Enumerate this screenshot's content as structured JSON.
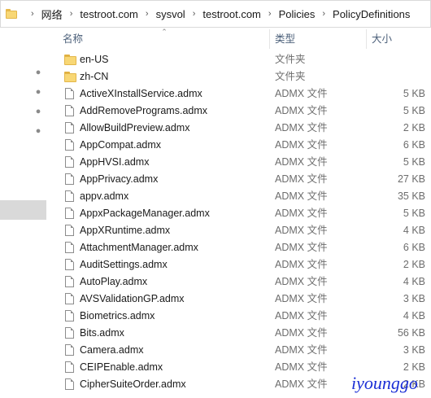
{
  "address_bar": {
    "crumbs": [
      "网络",
      "testroot.com",
      "sysvol",
      "testroot.com",
      "Policies",
      "PolicyDefinitions"
    ],
    "separator": "›"
  },
  "columns": {
    "name": "名称",
    "type": "类型",
    "size": "大小"
  },
  "files": [
    {
      "name": "en-US",
      "type": "文件夹",
      "size": "",
      "icon": "folder-icon"
    },
    {
      "name": "zh-CN",
      "type": "文件夹",
      "size": "",
      "icon": "folder-icon"
    },
    {
      "name": "ActiveXInstallService.admx",
      "type": "ADMX 文件",
      "size": "5 KB",
      "icon": "document-icon"
    },
    {
      "name": "AddRemovePrograms.admx",
      "type": "ADMX 文件",
      "size": "5 KB",
      "icon": "document-icon"
    },
    {
      "name": "AllowBuildPreview.admx",
      "type": "ADMX 文件",
      "size": "2 KB",
      "icon": "document-icon"
    },
    {
      "name": "AppCompat.admx",
      "type": "ADMX 文件",
      "size": "6 KB",
      "icon": "document-icon"
    },
    {
      "name": "AppHVSI.admx",
      "type": "ADMX 文件",
      "size": "5 KB",
      "icon": "document-icon"
    },
    {
      "name": "AppPrivacy.admx",
      "type": "ADMX 文件",
      "size": "27 KB",
      "icon": "document-icon"
    },
    {
      "name": "appv.admx",
      "type": "ADMX 文件",
      "size": "35 KB",
      "icon": "document-icon"
    },
    {
      "name": "AppxPackageManager.admx",
      "type": "ADMX 文件",
      "size": "5 KB",
      "icon": "document-icon"
    },
    {
      "name": "AppXRuntime.admx",
      "type": "ADMX 文件",
      "size": "4 KB",
      "icon": "document-icon"
    },
    {
      "name": "AttachmentManager.admx",
      "type": "ADMX 文件",
      "size": "6 KB",
      "icon": "document-icon"
    },
    {
      "name": "AuditSettings.admx",
      "type": "ADMX 文件",
      "size": "2 KB",
      "icon": "document-icon"
    },
    {
      "name": "AutoPlay.admx",
      "type": "ADMX 文件",
      "size": "4 KB",
      "icon": "document-icon"
    },
    {
      "name": "AVSValidationGP.admx",
      "type": "ADMX 文件",
      "size": "3 KB",
      "icon": "document-icon"
    },
    {
      "name": "Biometrics.admx",
      "type": "ADMX 文件",
      "size": "4 KB",
      "icon": "document-icon"
    },
    {
      "name": "Bits.admx",
      "type": "ADMX 文件",
      "size": "56 KB",
      "icon": "document-icon"
    },
    {
      "name": "Camera.admx",
      "type": "ADMX 文件",
      "size": "3 KB",
      "icon": "document-icon"
    },
    {
      "name": "CEIPEnable.admx",
      "type": "ADMX 文件",
      "size": "2 KB",
      "icon": "document-icon"
    },
    {
      "name": "CipherSuiteOrder.admx",
      "type": "ADMX 文件",
      "size": "2 KB",
      "icon": "document-icon"
    }
  ],
  "watermark": "iyounggo",
  "colors": {
    "header_text": "#4c607a",
    "folder_fill": "#f8d775",
    "nav_selected": "#d9d9d9",
    "watermark": "#1b2fd6"
  }
}
